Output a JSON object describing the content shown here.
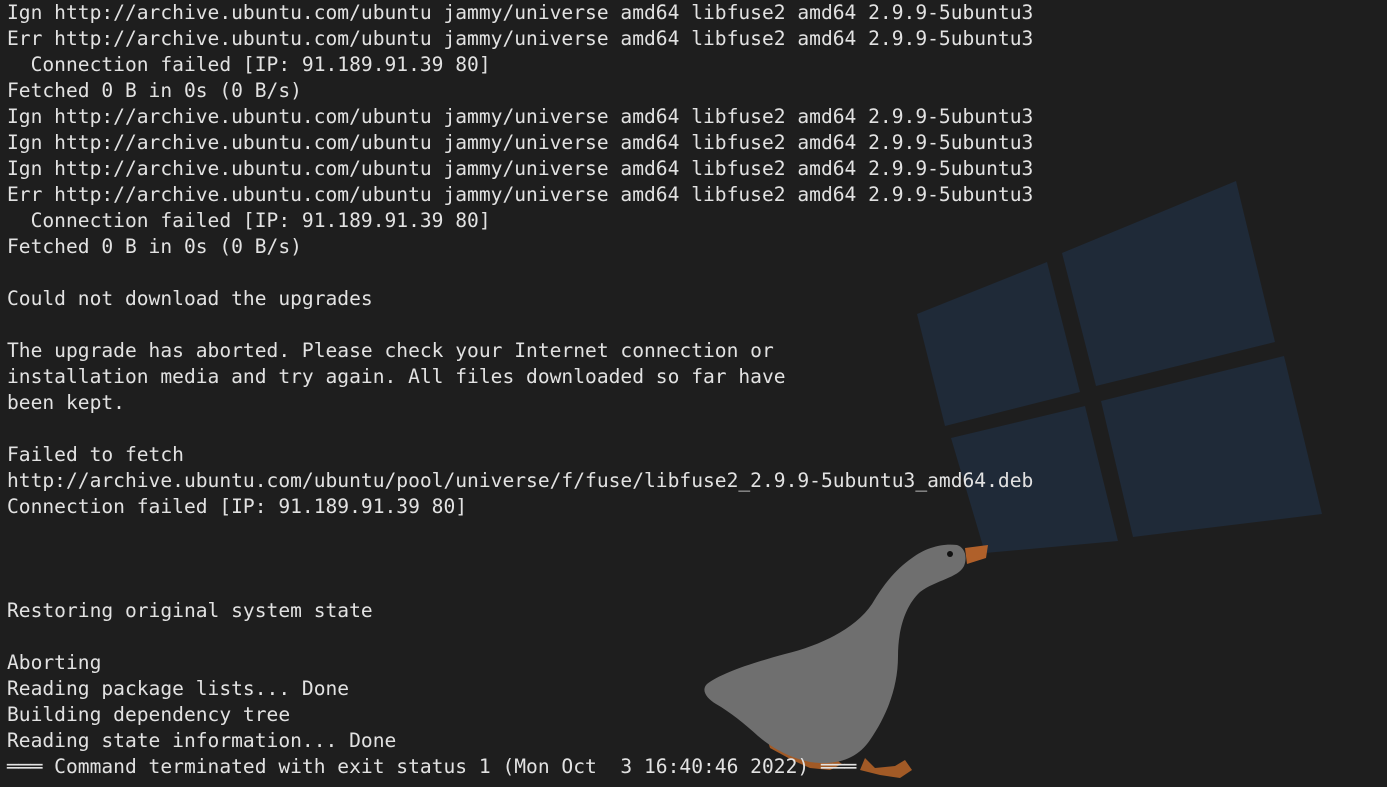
{
  "terminal": {
    "lines": [
      "Ign http://archive.ubuntu.com/ubuntu jammy/universe amd64 libfuse2 amd64 2.9.9-5ubuntu3",
      "Err http://archive.ubuntu.com/ubuntu jammy/universe amd64 libfuse2 amd64 2.9.9-5ubuntu3",
      "  Connection failed [IP: 91.189.91.39 80]",
      "Fetched 0 B in 0s (0 B/s)",
      "Ign http://archive.ubuntu.com/ubuntu jammy/universe amd64 libfuse2 amd64 2.9.9-5ubuntu3",
      "Ign http://archive.ubuntu.com/ubuntu jammy/universe amd64 libfuse2 amd64 2.9.9-5ubuntu3",
      "Ign http://archive.ubuntu.com/ubuntu jammy/universe amd64 libfuse2 amd64 2.9.9-5ubuntu3",
      "Err http://archive.ubuntu.com/ubuntu jammy/universe amd64 libfuse2 amd64 2.9.9-5ubuntu3",
      "  Connection failed [IP: 91.189.91.39 80]",
      "Fetched 0 B in 0s (0 B/s)",
      "",
      "Could not download the upgrades",
      "",
      "The upgrade has aborted. Please check your Internet connection or",
      "installation media and try again. All files downloaded so far have",
      "been kept.",
      "",
      "Failed to fetch",
      "http://archive.ubuntu.com/ubuntu/pool/universe/f/fuse/libfuse2_2.9.9-5ubuntu3_amd64.deb",
      "Connection failed [IP: 91.189.91.39 80]",
      "",
      "",
      "",
      "Restoring original system state",
      "",
      "Aborting",
      "Reading package lists... Done",
      "Building dependency tree",
      "Reading state information... Done",
      "═══ Command terminated with exit status 1 (Mon Oct  3 16:40:46 2022) ═══"
    ]
  },
  "wallpaper": {
    "logo_icon": "windows-logo-icon",
    "goose_icon": "goose-icon",
    "logo_color": "#1f2a38",
    "goose_body_color": "#6f6f6f",
    "goose_beak_color": "#b0602a"
  },
  "colors": {
    "background": "#1e1e1e",
    "text": "#e2e2e2"
  }
}
